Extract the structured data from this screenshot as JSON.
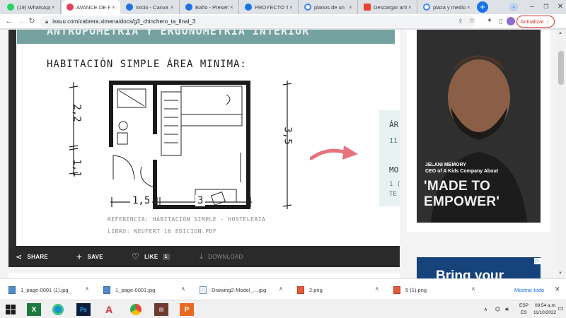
{
  "tabs": [
    {
      "label": "(19) WhatsApp",
      "fav_color": "#25d366",
      "icon": "whatsapp-icon"
    },
    {
      "label": "AVANCE DE PI",
      "fav_color": "#e4405f",
      "icon": "instagram-icon",
      "active": true
    },
    {
      "label": "Inicio - Canva",
      "fav_color": "#1a73e8",
      "icon": "canva-icon"
    },
    {
      "label": "Baño - Presen",
      "fav_color": "#1a73e8",
      "icon": "canva-icon"
    },
    {
      "label": "PROYECTO TU",
      "fav_color": "#1a73e8",
      "icon": "canva-icon"
    },
    {
      "label": "planos de un",
      "fav_color": "#4285f4",
      "icon": "google-icon"
    },
    {
      "label": "Descargar arti",
      "fav_color": "#ea4335",
      "icon": "heart-icon"
    },
    {
      "label": "plaza y medio",
      "fav_color": "#4285f4",
      "icon": "google-icon"
    }
  ],
  "toolbar": {
    "url": "issuu.com/cabrera.ximena/docs/g3_chinchero_ta_final_3",
    "update_label": "Actualizar"
  },
  "document": {
    "band_text": "ANTROPOMETRIA Y ERGONOMETRIA INTERIOR",
    "title": "HABITACIÒN SIMPLE ÁREA MINIMA:",
    "dim_left_top": "2,2",
    "dim_left_bottom": "1,1",
    "dim_right": "3,5",
    "dim_bottom_left": "1,5",
    "dim_bottom_right": "3",
    "reference": "REFERENCIA: HABITACIÓN SIMPLE - HOSTELERIA",
    "book": "LIBRO: NEUFERT 16 EDICION.PDF",
    "arrow_color": "#e8737e",
    "next_page": {
      "line1": "ÁR",
      "line2": "11",
      "line3": "MO",
      "line4": "1 (",
      "line5": "TE"
    }
  },
  "viewer": {
    "share": "SHARE",
    "save": "SAVE",
    "like": "LIKE",
    "like_count": "1",
    "download": "DOWNLOAD"
  },
  "ad": {
    "name": "JELANI MEMORY",
    "role": "CEO of A Kids Company About",
    "headline_1": "'MADE TO",
    "headline_2": "EMPOWER'",
    "ad2_text": "Bring your"
  },
  "downloads": [
    {
      "name": "1_page-0001 (1).jpg",
      "icon": "image-file-icon"
    },
    {
      "name": "1_page-0001.jpg",
      "icon": "image-file-icon"
    },
    {
      "name": "Drawing2-Model_....jpg",
      "icon": "image-file-icon"
    },
    {
      "name": "2.png",
      "icon": "png-file-icon"
    },
    {
      "name": "5 (1).png",
      "icon": "png-file-icon"
    }
  ],
  "show_all": "Mostrar todo",
  "taskbar": {
    "lang_1": "ESP",
    "lang_2": "ES",
    "time": "08:54 a.m.",
    "date": "11/10/2022"
  }
}
